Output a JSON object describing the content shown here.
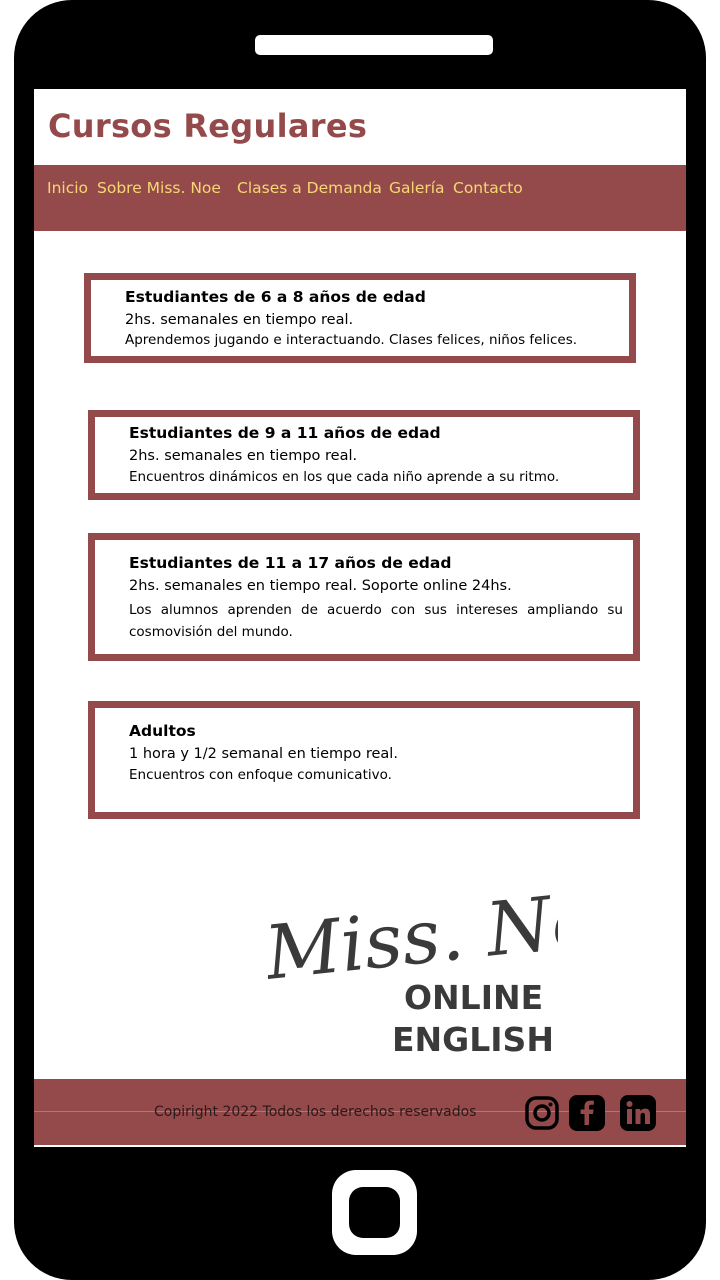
{
  "page": {
    "title": "Cursos Regulares"
  },
  "nav": {
    "items": [
      {
        "label": "Inicio"
      },
      {
        "label": "Sobre Miss. Noe"
      },
      {
        "label": "Clases a Demanda"
      },
      {
        "label": "Galería"
      },
      {
        "label": "Contacto"
      }
    ]
  },
  "courses": [
    {
      "title": "Estudiantes de 6 a 8 años de edad",
      "schedule": "2hs. semanales en tiempo real.",
      "description": "Aprendemos jugando e interactuando. Clases felices, niños felices."
    },
    {
      "title": "Estudiantes de 9 a 11 años de edad",
      "schedule": "2hs. semanales en tiempo real.",
      "description": "Encuentros dinámicos en los que cada niño aprende a su ritmo."
    },
    {
      "title": "Estudiantes de 11 a 17 años de edad",
      "schedule": "2hs. semanales en tiempo real. Soporte online 24hs.",
      "description": "Los alumnos aprenden de acuerdo con sus intereses ampliando su cosmovisión del mundo."
    },
    {
      "title": "Adultos",
      "schedule": "1 hora y 1/2 semanal en tiempo real.",
      "description": "Encuentros con enfoque comunicativo."
    }
  ],
  "logo": {
    "script_text": "Miss. Noe",
    "line1": "ONLINE",
    "line2": "ENGLISH"
  },
  "footer": {
    "copyright": "Copiright 2022 Todos los derechos reservados",
    "social": [
      {
        "icon": "instagram-icon"
      },
      {
        "icon": "facebook-icon"
      },
      {
        "icon": "linkedin-icon"
      }
    ]
  },
  "colors": {
    "brand": "#944a4a",
    "nav_text": "#f5d873",
    "phone": "#000000"
  }
}
